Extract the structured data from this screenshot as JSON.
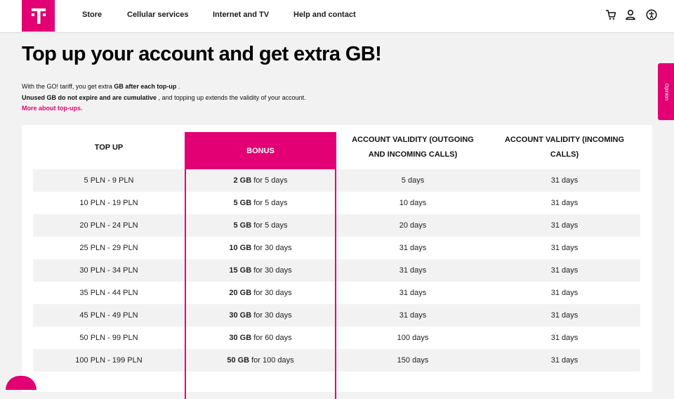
{
  "header": {
    "logo_letter": "T",
    "nav": [
      "Store",
      "Cellular services",
      "Internet and TV",
      "Help and contact"
    ],
    "icons": [
      "cart-icon",
      "user-icon",
      "accessibility-icon"
    ]
  },
  "intro": {
    "title": "Top up your account and get extra GB!",
    "line1_a": "With the GO! tariff, you get extra ",
    "line1_b": "GB after each top-up",
    "line1_c": " .",
    "line2_a": "Unused GB do not expire and are cumulative",
    "line2_b": " , and topping up extends the validity of your account.",
    "more_link": "More about top-ups."
  },
  "opinion_tab": "Opinion",
  "table": {
    "headers": {
      "top_up": "TOP UP",
      "bonus": "BONUS",
      "validity_out_1": "ACCOUNT VALIDITY (OUTGOING",
      "validity_out_2": "AND INCOMING CALLS)",
      "validity_in_1": "ACCOUNT VALIDITY (INCOMING",
      "validity_in_2": "CALLS)"
    },
    "rows": [
      {
        "top_up": "5 PLN - 9 PLN",
        "bonus_gb": "2 GB",
        "bonus_days": "for 5 days",
        "validity_out": "5 days",
        "validity_in": "31 days"
      },
      {
        "top_up": "10 PLN - 19 PLN",
        "bonus_gb": "5 GB",
        "bonus_days": "for 5 days",
        "validity_out": "10 days",
        "validity_in": "31 days"
      },
      {
        "top_up": "20 PLN - 24 PLN",
        "bonus_gb": "5 GB",
        "bonus_days": "for 5 days",
        "validity_out": "20 days",
        "validity_in": "31 days"
      },
      {
        "top_up": "25 PLN - 29 PLN",
        "bonus_gb": "10 GB",
        "bonus_days": "for 30 days",
        "validity_out": "31 days",
        "validity_in": "31 days"
      },
      {
        "top_up": "30 PLN - 34 PLN",
        "bonus_gb": "15 GB",
        "bonus_days": "for 30 days",
        "validity_out": "31 days",
        "validity_in": "31 days"
      },
      {
        "top_up": "35 PLN - 44 PLN",
        "bonus_gb": "20 GB",
        "bonus_days": "for 30 days",
        "validity_out": "31 days",
        "validity_in": "31 days"
      },
      {
        "top_up": "45 PLN - 49 PLN",
        "bonus_gb": "30 GB",
        "bonus_days": "for 30 days",
        "validity_out": "31 days",
        "validity_in": "31 days"
      },
      {
        "top_up": "50 PLN - 99 PLN",
        "bonus_gb": "30 GB",
        "bonus_days": "for 60 days",
        "validity_out": "100 days",
        "validity_in": "31 days"
      },
      {
        "top_up": "100 PLN - 199 PLN",
        "bonus_gb": "50 GB",
        "bonus_days": "for 100 days",
        "validity_out": "150 days",
        "validity_in": "31 days"
      }
    ]
  },
  "colors": {
    "brand": "#e20074",
    "background": "#f2f2f2",
    "row_shade": "#f2f2f2"
  }
}
